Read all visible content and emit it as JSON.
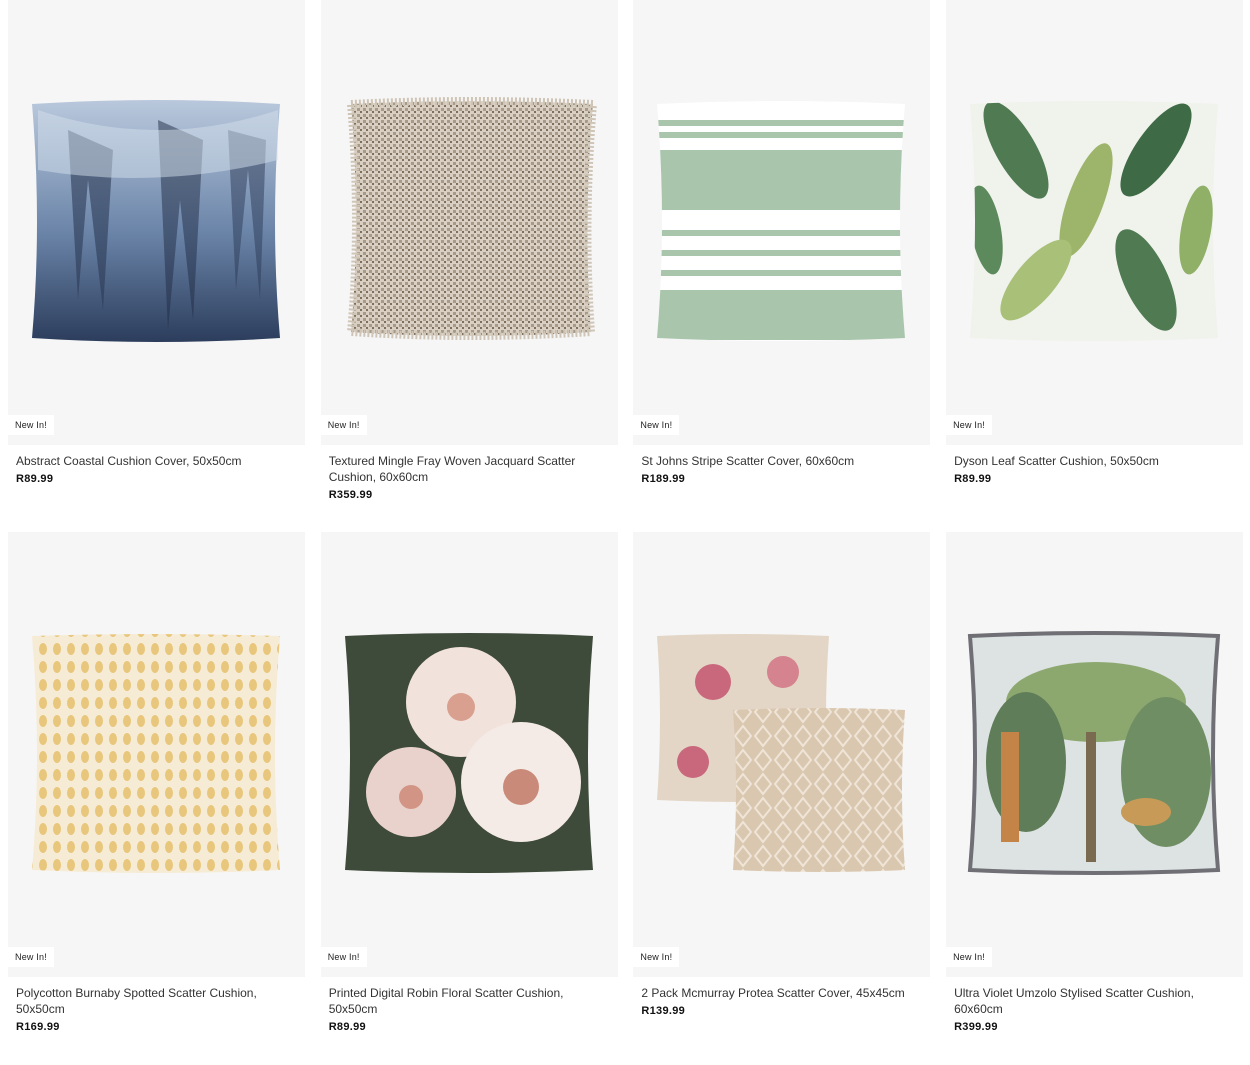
{
  "products": [
    {
      "badge": "New In!",
      "title": "Abstract Coastal Cushion Cover, 50x50cm",
      "price": "R89.99"
    },
    {
      "badge": "New In!",
      "title": "Textured Mingle Fray Woven Jacquard Scatter Cushion, 60x60cm",
      "price": "R359.99"
    },
    {
      "badge": "New In!",
      "title": "St Johns Stripe Scatter Cover, 60x60cm",
      "price": "R189.99"
    },
    {
      "badge": "New In!",
      "title": "Dyson Leaf Scatter Cushion, 50x50cm",
      "price": "R89.99"
    },
    {
      "badge": "New In!",
      "title": "Polycotton Burnaby Spotted Scatter Cushion, 50x50cm",
      "price": "R169.99"
    },
    {
      "badge": "New In!",
      "title": "Printed Digital Robin Floral Scatter Cushion, 50x50cm",
      "price": "R89.99"
    },
    {
      "badge": "New In!",
      "title": "2 Pack Mcmurray Protea Scatter Cover, 45x45cm",
      "price": "R139.99"
    },
    {
      "badge": "New In!",
      "title": "Ultra Violet Umzolo Stylised Scatter Cushion, 60x60cm",
      "price": "R399.99"
    }
  ]
}
